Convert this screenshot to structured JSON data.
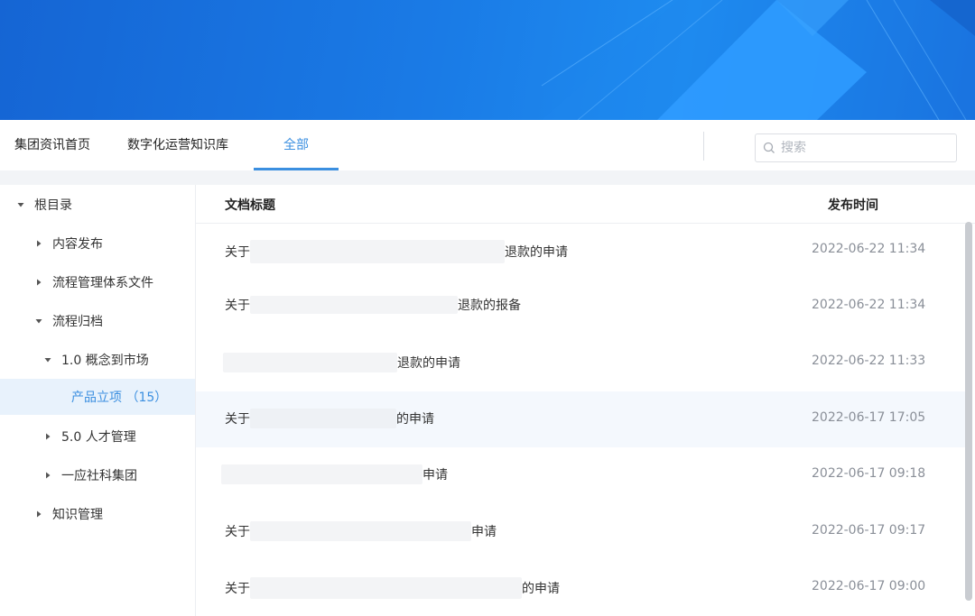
{
  "nav": {
    "tabs": [
      {
        "label": "集团资讯首页"
      },
      {
        "label": "数字化运营知识库"
      },
      {
        "label": "全部"
      }
    ]
  },
  "search": {
    "placeholder": "搜索",
    "value": ""
  },
  "sidebar": {
    "items": [
      {
        "label": "根目录",
        "expanded": true
      },
      {
        "label": "内容发布",
        "expanded": false
      },
      {
        "label": "流程管理体系文件",
        "expanded": false
      },
      {
        "label": "流程归档",
        "expanded": true
      },
      {
        "label": "1.0 概念到市场",
        "expanded": true
      },
      {
        "label": "产品立项 （15）",
        "selected": true
      },
      {
        "label": "5.0 人才管理",
        "expanded": false
      },
      {
        "label": "一应社科集团",
        "expanded": false
      },
      {
        "label": "知识管理",
        "expanded": false
      }
    ]
  },
  "table": {
    "headers": {
      "title": "文档标题",
      "time": "发布时间"
    },
    "rows": [
      {
        "prefix": "关于",
        "suffix": "退款的申请",
        "time": "2022-06-22 11:34"
      },
      {
        "prefix": "关于",
        "suffix": "退款的报备",
        "time": "2022-06-22 11:34"
      },
      {
        "prefix": "",
        "suffix": "退款的申请",
        "time": "2022-06-22 11:33"
      },
      {
        "prefix": "关于",
        "suffix": "的申请",
        "time": "2022-06-17 17:05"
      },
      {
        "prefix": "",
        "suffix": "申请",
        "time": "2022-06-17 09:18"
      },
      {
        "prefix": "关于",
        "suffix": "申请",
        "time": "2022-06-17 09:17"
      },
      {
        "prefix": "关于",
        "suffix": "的申请",
        "time": "2022-06-17 09:00"
      }
    ]
  },
  "colors": {
    "accent": "#3b8fe0",
    "banner": "#1a7be6",
    "selected_bg": "#e8f2fc"
  }
}
